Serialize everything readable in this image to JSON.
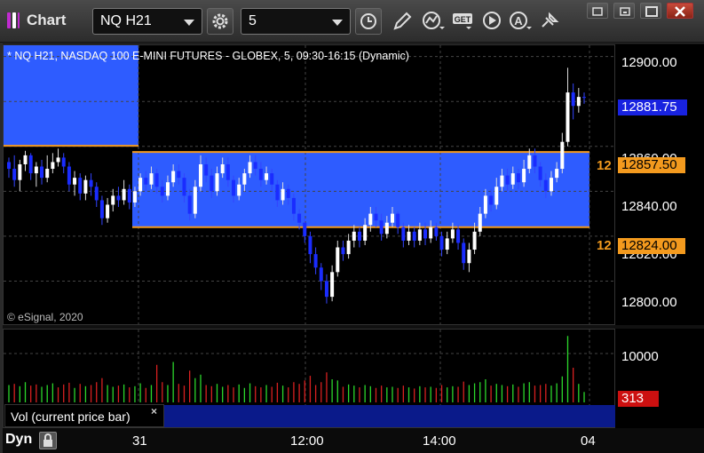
{
  "app": {
    "title": "Chart",
    "logo_colors": [
      "#c02bd0",
      "#ffffff",
      "#c02bd0"
    ]
  },
  "toolbar": {
    "symbol_value": "NQ H21",
    "interval_value": "5",
    "buttons": [
      "settings-icon",
      "clock-icon",
      "pencil-icon",
      "studies-icon",
      "get-icon",
      "play-icon",
      "alert-icon",
      "pin-icon"
    ],
    "get_label": "GET",
    "alert_label": "A"
  },
  "window_controls": [
    "restore-icon",
    "maximize-icon",
    "close-icon"
  ],
  "chart": {
    "title": "* NQ H21, NASDAQ 100 E-MINI FUTURES - GLOBEX, 5, 09:30-16:15 (Dynamic)",
    "copyright": "© eSignal, 2020",
    "price_ticks": [
      "12900.00",
      "12860.00",
      "12840.00",
      "12820.00",
      "12800.00"
    ],
    "last_price": "12881.75",
    "upper_level": "12857.50",
    "lower_level": "12824.00",
    "upper_level_left_tag": "12",
    "lower_level_left_tag": "12",
    "volume_tick": "10000",
    "volume_value": "313",
    "volume_study_label": "Vol (current price bar)",
    "close_glyph": "×",
    "dyn_label": "Dyn",
    "time_ticks": [
      "31",
      "12:00",
      "14:00",
      "04"
    ],
    "colors": {
      "range_fill": "#2e5cff",
      "level_line": "#f39a1e",
      "up_candle": "#ffffff",
      "down_candle": "#1a2cff",
      "vol_up": "#2bd82b",
      "vol_down": "#d82020"
    }
  },
  "chart_data": {
    "type": "candlestick",
    "y_price_lim": [
      12780,
      12905
    ],
    "levels": [
      12857.5,
      12824.0
    ],
    "candles": [
      [
        12853,
        12850,
        12855,
        12846
      ],
      [
        12850,
        12845,
        12856,
        12842
      ],
      [
        12845,
        12852,
        12854,
        12840
      ],
      [
        12852,
        12856,
        12858,
        12849
      ],
      [
        12856,
        12848,
        12857,
        12845
      ],
      [
        12848,
        12851,
        12853,
        12842
      ],
      [
        12851,
        12846,
        12854,
        12843
      ],
      [
        12846,
        12850,
        12856,
        12844
      ],
      [
        12850,
        12853,
        12857,
        12848
      ],
      [
        12853,
        12855,
        12859,
        12851
      ],
      [
        12855,
        12851,
        12857,
        12848
      ],
      [
        12851,
        12843,
        12853,
        12840
      ],
      [
        12843,
        12846,
        12849,
        12838
      ],
      [
        12846,
        12839,
        12848,
        12836
      ],
      [
        12839,
        12845,
        12847,
        12836
      ],
      [
        12845,
        12842,
        12848,
        12838
      ],
      [
        12842,
        12836,
        12844,
        12833
      ],
      [
        12836,
        12828,
        12838,
        12825
      ],
      [
        12828,
        12834,
        12837,
        12826
      ],
      [
        12834,
        12838,
        12841,
        12831
      ],
      [
        12838,
        12836,
        12842,
        12833
      ],
      [
        12836,
        12841,
        12845,
        12834
      ],
      [
        12841,
        12835,
        12843,
        12832
      ],
      [
        12835,
        12840,
        12842,
        12833
      ],
      [
        12840,
        12846,
        12848,
        12838
      ],
      [
        12846,
        12843,
        12849,
        12840
      ],
      [
        12843,
        12848,
        12851,
        12841
      ],
      [
        12848,
        12842,
        12850,
        12839
      ],
      [
        12842,
        12838,
        12845,
        12835
      ],
      [
        12838,
        12844,
        12847,
        12836
      ],
      [
        12844,
        12849,
        12852,
        12842
      ],
      [
        12849,
        12846,
        12852,
        12843
      ],
      [
        12846,
        12838,
        12848,
        12835
      ],
      [
        12838,
        12830,
        12841,
        12827
      ],
      [
        12830,
        12842,
        12845,
        12828
      ],
      [
        12842,
        12852,
        12856,
        12840
      ],
      [
        12852,
        12847,
        12855,
        12844
      ],
      [
        12847,
        12840,
        12850,
        12837
      ],
      [
        12840,
        12848,
        12851,
        12838
      ],
      [
        12848,
        12852,
        12855,
        12846
      ],
      [
        12852,
        12845,
        12855,
        12842
      ],
      [
        12845,
        12838,
        12847,
        12835
      ],
      [
        12838,
        12843,
        12846,
        12836
      ],
      [
        12843,
        12848,
        12850,
        12840
      ],
      [
        12848,
        12853,
        12856,
        12846
      ],
      [
        12853,
        12850,
        12856,
        12847
      ],
      [
        12850,
        12845,
        12853,
        12842
      ],
      [
        12845,
        12848,
        12851,
        12843
      ],
      [
        12848,
        12843,
        12850,
        12840
      ],
      [
        12843,
        12836,
        12845,
        12833
      ],
      [
        12836,
        12841,
        12844,
        12834
      ],
      [
        12841,
        12837,
        12843,
        12834
      ],
      [
        12837,
        12830,
        12839,
        12827
      ],
      [
        12830,
        12826,
        12832,
        12823
      ],
      [
        12826,
        12820,
        12828,
        12817
      ],
      [
        12820,
        12812,
        12822,
        12808
      ],
      [
        12812,
        12806,
        12815,
        12803
      ],
      [
        12806,
        12800,
        12808,
        12796
      ],
      [
        12800,
        12793,
        12803,
        12790
      ],
      [
        12793,
        12804,
        12807,
        12791
      ],
      [
        12804,
        12815,
        12818,
        12802
      ],
      [
        12815,
        12812,
        12818,
        12809
      ],
      [
        12812,
        12818,
        12821,
        12810
      ],
      [
        12818,
        12822,
        12825,
        12815
      ],
      [
        12822,
        12818,
        12824,
        12815
      ],
      [
        12818,
        12825,
        12828,
        12816
      ],
      [
        12825,
        12830,
        12833,
        12822
      ],
      [
        12830,
        12827,
        12833,
        12824
      ],
      [
        12827,
        12821,
        12830,
        12818
      ],
      [
        12821,
        12826,
        12829,
        12819
      ],
      [
        12826,
        12830,
        12833,
        12824
      ],
      [
        12830,
        12824,
        12831,
        12821
      ],
      [
        12824,
        12818,
        12826,
        12815
      ],
      [
        12818,
        12822,
        12825,
        12816
      ],
      [
        12822,
        12818,
        12824,
        12815
      ],
      [
        12818,
        12823,
        12826,
        12816
      ],
      [
        12823,
        12819,
        12826,
        12816
      ],
      [
        12819,
        12824,
        12827,
        12817
      ],
      [
        12824,
        12820,
        12826,
        12818
      ],
      [
        12820,
        12814,
        12822,
        12811
      ],
      [
        12814,
        12819,
        12822,
        12812
      ],
      [
        12819,
        12823,
        12826,
        12817
      ],
      [
        12823,
        12817,
        12825,
        12814
      ],
      [
        12817,
        12808,
        12819,
        12805
      ],
      [
        12808,
        12814,
        12817,
        12804
      ],
      [
        12814,
        12822,
        12826,
        12812
      ],
      [
        12822,
        12830,
        12833,
        12820
      ],
      [
        12830,
        12838,
        12841,
        12828
      ],
      [
        12838,
        12834,
        12841,
        12831
      ],
      [
        12834,
        12842,
        12846,
        12832
      ],
      [
        12842,
        12847,
        12850,
        12840
      ],
      [
        12847,
        12843,
        12850,
        12840
      ],
      [
        12843,
        12848,
        12851,
        12841
      ],
      [
        12848,
        12844,
        12850,
        12841
      ],
      [
        12844,
        12850,
        12854,
        12842
      ],
      [
        12850,
        12856,
        12859,
        12848
      ],
      [
        12856,
        12851,
        12859,
        12848
      ],
      [
        12851,
        12845,
        12853,
        12842
      ],
      [
        12845,
        12840,
        12848,
        12837
      ],
      [
        12840,
        12846,
        12849,
        12838
      ],
      [
        12846,
        12850,
        12853,
        12844
      ],
      [
        12850,
        12862,
        12866,
        12848
      ],
      [
        12862,
        12884,
        12895,
        12860
      ],
      [
        12884,
        12878,
        12888,
        12872
      ],
      [
        12878,
        12882,
        12886,
        12875
      ],
      [
        12882,
        12881.75,
        12884,
        12879
      ]
    ],
    "volume": [
      [
        3000,
        1
      ],
      [
        3200,
        0
      ],
      [
        2800,
        1
      ],
      [
        3500,
        1
      ],
      [
        2900,
        0
      ],
      [
        3100,
        0
      ],
      [
        2700,
        1
      ],
      [
        3000,
        1
      ],
      [
        3300,
        1
      ],
      [
        2600,
        0
      ],
      [
        3100,
        0
      ],
      [
        3400,
        0
      ],
      [
        2500,
        1
      ],
      [
        3200,
        0
      ],
      [
        2800,
        1
      ],
      [
        3000,
        0
      ],
      [
        3500,
        0
      ],
      [
        4200,
        0
      ],
      [
        3000,
        1
      ],
      [
        2700,
        1
      ],
      [
        2900,
        0
      ],
      [
        3100,
        1
      ],
      [
        2600,
        0
      ],
      [
        2800,
        1
      ],
      [
        3300,
        1
      ],
      [
        2500,
        0
      ],
      [
        3000,
        1
      ],
      [
        6500,
        0
      ],
      [
        3500,
        0
      ],
      [
        3000,
        1
      ],
      [
        7000,
        1
      ],
      [
        3200,
        0
      ],
      [
        2900,
        0
      ],
      [
        5500,
        0
      ],
      [
        4200,
        1
      ],
      [
        4800,
        1
      ],
      [
        3000,
        0
      ],
      [
        2800,
        0
      ],
      [
        3200,
        1
      ],
      [
        2700,
        1
      ],
      [
        3000,
        0
      ],
      [
        2600,
        0
      ],
      [
        3100,
        1
      ],
      [
        2500,
        1
      ],
      [
        3300,
        1
      ],
      [
        2800,
        0
      ],
      [
        2600,
        0
      ],
      [
        3000,
        1
      ],
      [
        2700,
        0
      ],
      [
        3400,
        0
      ],
      [
        2900,
        1
      ],
      [
        2600,
        0
      ],
      [
        3500,
        0
      ],
      [
        3200,
        0
      ],
      [
        3800,
        0
      ],
      [
        4600,
        0
      ],
      [
        3000,
        0
      ],
      [
        3500,
        0
      ],
      [
        5200,
        0
      ],
      [
        4000,
        1
      ],
      [
        3800,
        1
      ],
      [
        2700,
        0
      ],
      [
        3100,
        1
      ],
      [
        2900,
        1
      ],
      [
        2600,
        0
      ],
      [
        3000,
        1
      ],
      [
        2800,
        1
      ],
      [
        2500,
        0
      ],
      [
        2900,
        0
      ],
      [
        2600,
        1
      ],
      [
        2700,
        1
      ],
      [
        2500,
        0
      ],
      [
        2900,
        0
      ],
      [
        2600,
        1
      ],
      [
        2400,
        0
      ],
      [
        2800,
        1
      ],
      [
        2600,
        0
      ],
      [
        2700,
        1
      ],
      [
        2500,
        0
      ],
      [
        3000,
        0
      ],
      [
        2600,
        1
      ],
      [
        2800,
        1
      ],
      [
        2700,
        0
      ],
      [
        3600,
        0
      ],
      [
        3000,
        1
      ],
      [
        3300,
        1
      ],
      [
        3500,
        1
      ],
      [
        4000,
        1
      ],
      [
        2900,
        0
      ],
      [
        3200,
        1
      ],
      [
        3000,
        1
      ],
      [
        2800,
        0
      ],
      [
        3100,
        1
      ],
      [
        2700,
        0
      ],
      [
        3300,
        1
      ],
      [
        3500,
        1
      ],
      [
        2900,
        0
      ],
      [
        3000,
        0
      ],
      [
        3200,
        0
      ],
      [
        2900,
        1
      ],
      [
        3300,
        1
      ],
      [
        4500,
        1
      ],
      [
        11500,
        1
      ],
      [
        6000,
        0
      ],
      [
        3200,
        1
      ],
      [
        1800,
        1
      ]
    ],
    "volume_max": 12000
  }
}
